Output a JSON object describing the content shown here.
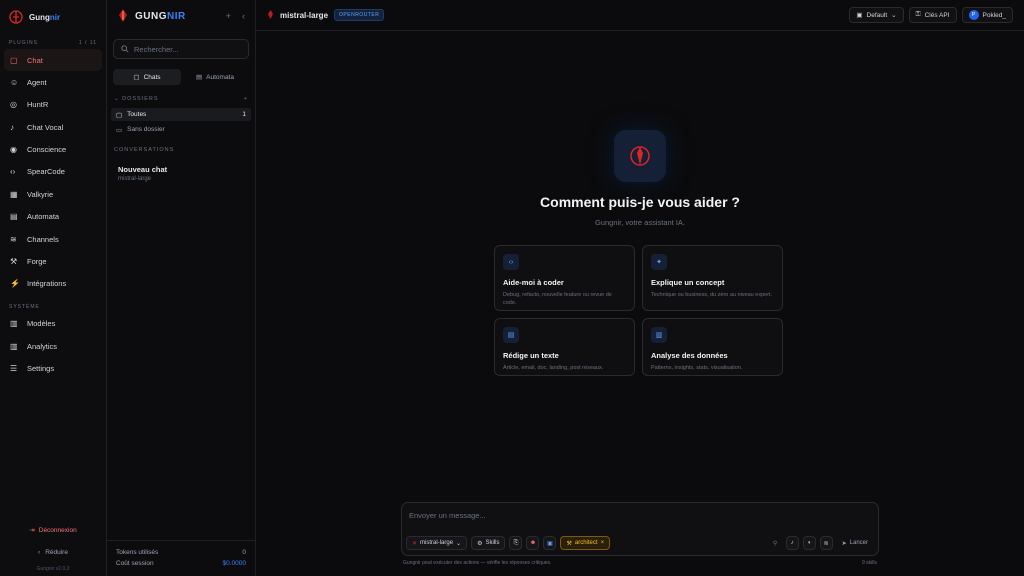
{
  "sidebar": {
    "brand": {
      "part1": "Gung",
      "part2": "nir"
    },
    "plugins_label": "PLUGINS",
    "plugins_count": "1 / 11",
    "items": [
      {
        "label": "Chat",
        "icon": "chat-icon"
      },
      {
        "label": "Agent",
        "icon": "agent-icon"
      },
      {
        "label": "HuntR",
        "icon": "globe-icon"
      },
      {
        "label": "Chat Vocal",
        "icon": "mic-icon"
      },
      {
        "label": "Conscience",
        "icon": "brain-icon"
      },
      {
        "label": "SpearCode",
        "icon": "code-icon"
      },
      {
        "label": "Valkyrie",
        "icon": "grid-icon"
      },
      {
        "label": "Automata",
        "icon": "calendar-icon"
      },
      {
        "label": "Channels",
        "icon": "signal-icon"
      },
      {
        "label": "Forge",
        "icon": "wrench-icon"
      },
      {
        "label": "Intégrations",
        "icon": "plug-icon"
      }
    ],
    "system_label": "SYSTÈME",
    "system_items": [
      {
        "label": "Modèles",
        "icon": "book-icon"
      },
      {
        "label": "Analytics",
        "icon": "chart-icon"
      },
      {
        "label": "Settings",
        "icon": "sliders-icon"
      }
    ],
    "logout": "Déconnexion",
    "reduce": "Réduire",
    "version": "Gungnir v2.0.3"
  },
  "chatpanel": {
    "logo": {
      "part1": "GUNG",
      "part2": "NIR"
    },
    "search_placeholder": "Rechercher...",
    "tabs": {
      "chats": "Chats",
      "automata": "Automata"
    },
    "folders_label": "DOSSIERS",
    "folders": [
      {
        "label": "Toutes",
        "count": "1"
      },
      {
        "label": "Sans dossier",
        "count": ""
      }
    ],
    "conversations_label": "CONVERSATIONS",
    "conversation": {
      "title": "Nouveau chat",
      "model": "mistral-large"
    },
    "tokens_label": "Tokens utilisés",
    "tokens_value": "0",
    "cost_label": "Coût session",
    "cost_value": "$0.0000"
  },
  "topbar": {
    "model": "mistral-large",
    "provider": "OPENROUTER",
    "default_btn": "Default",
    "keys_btn": "Clés API",
    "user": "Pokled_",
    "user_initial": "P"
  },
  "hero": {
    "title": "Comment puis-je vous aider ?",
    "subtitle": "Gungnir, votre assistant IA."
  },
  "cards": [
    {
      "icon": "code-icon",
      "title": "Aide-moi à coder",
      "desc": "Debug, refacto, nouvelle feature ou revue de code."
    },
    {
      "icon": "sparkle-icon",
      "title": "Explique un concept",
      "desc": "Technique ou business, du zéro au niveau expert."
    },
    {
      "icon": "document-icon",
      "title": "Rédige un texte",
      "desc": "Article, email, doc, landing, post réseaux."
    },
    {
      "icon": "chart-icon",
      "title": "Analyse des données",
      "desc": "Patterns, insights, stats, visualisation."
    }
  ],
  "composer": {
    "placeholder": "Envoyer un message...",
    "model": "mistral-large",
    "skills": "Skills",
    "architect": "architect",
    "send": "Lancer",
    "disclaimer": "Gungnir peut exécuter des actions — vérifie les réponses critiques.",
    "skills_count": "9 skills"
  },
  "colors": {
    "accent": "#3b82f6",
    "danger": "#f87171",
    "gold": "#fbbf24"
  }
}
